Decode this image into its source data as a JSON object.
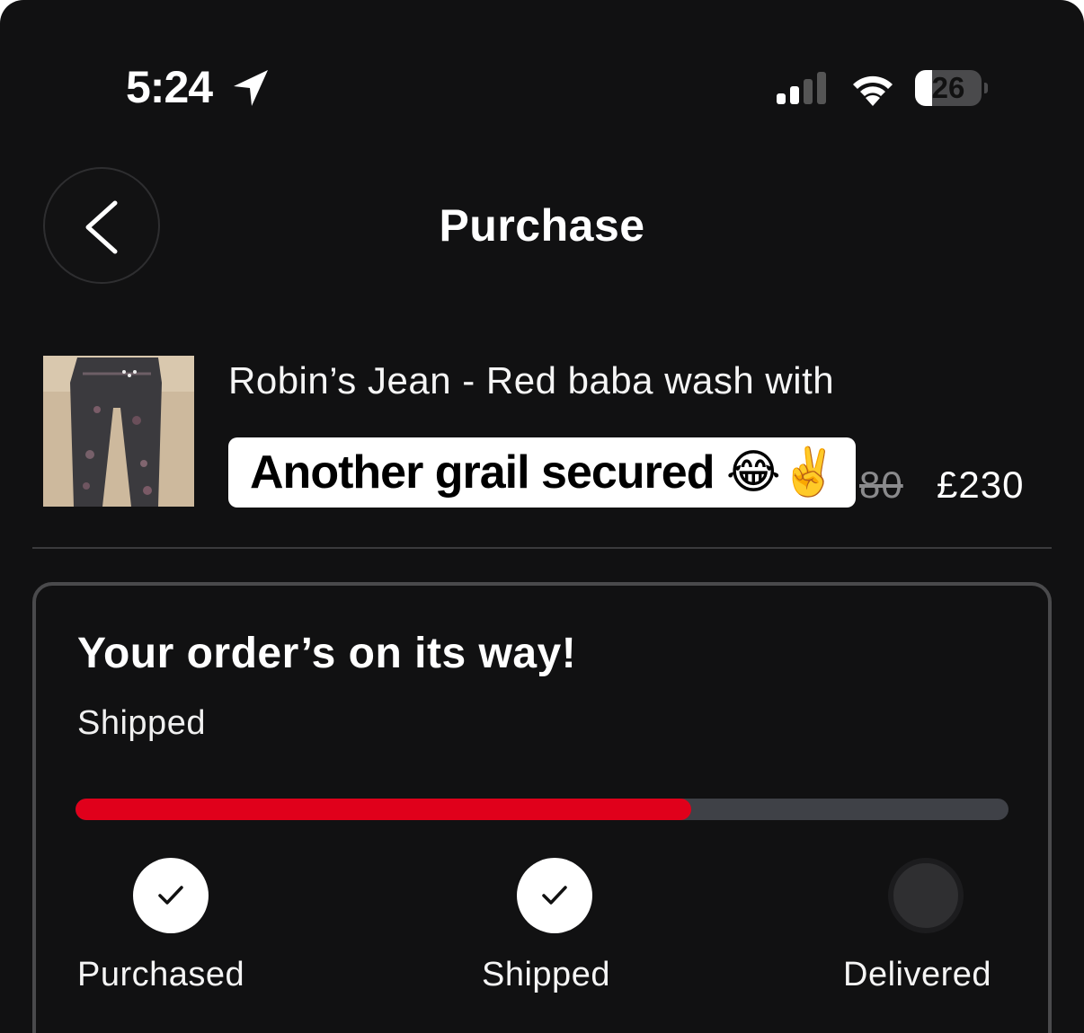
{
  "status_bar": {
    "time": "5:24",
    "battery_level": "26",
    "battery_fraction": 0.26
  },
  "header": {
    "title": "Purchase"
  },
  "product": {
    "name": "Robin’s Jean - Red baba wash with",
    "original_price": "80",
    "price": "£230"
  },
  "overlay": {
    "caption": "Another grail secured 😂✌️"
  },
  "order": {
    "headline": "Your order’s on its way!",
    "status": "Shipped",
    "progress_fraction": 0.66,
    "steps": [
      {
        "label": "Purchased",
        "done": true
      },
      {
        "label": "Shipped",
        "done": true
      },
      {
        "label": "Delivered",
        "done": false
      }
    ]
  },
  "colors": {
    "background": "#111112",
    "progress_fill": "#e0001b",
    "progress_track": "#3f4147"
  },
  "icons": [
    "location-arrow-icon",
    "cellular-signal-icon",
    "wifi-icon",
    "battery-icon",
    "back-chevron-icon",
    "checkmark-icon"
  ]
}
